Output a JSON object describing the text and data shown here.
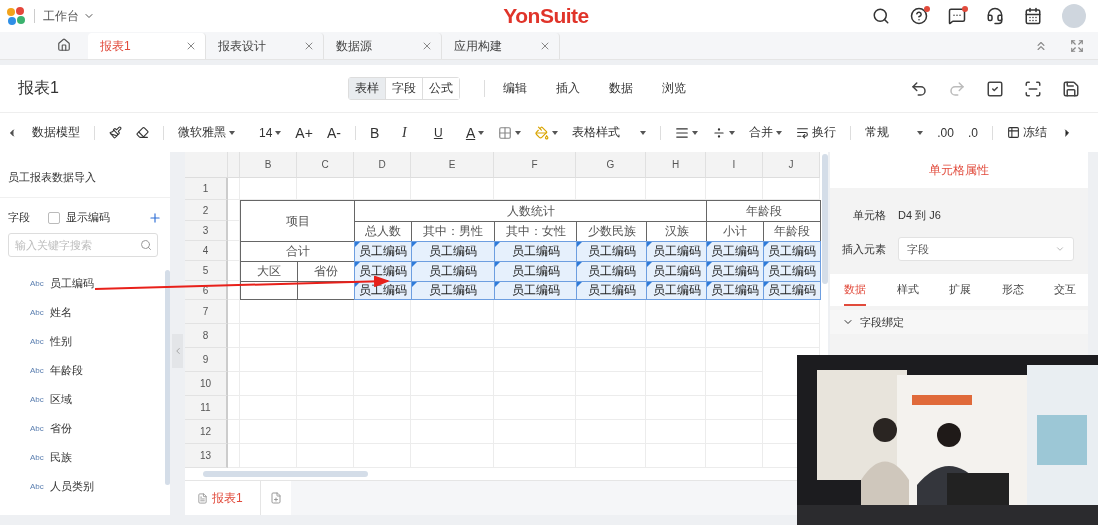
{
  "top_bar": {
    "workspace": "工作台",
    "brand": "YonSuite",
    "help_badge": true,
    "messages_badge": true
  },
  "tabs": [
    {
      "label": "报表1",
      "selected": true
    },
    {
      "label": "报表设计",
      "selected": false
    },
    {
      "label": "数据源",
      "selected": false
    },
    {
      "label": "应用构建",
      "selected": false
    }
  ],
  "header": {
    "title": "报表1",
    "modes": [
      {
        "label": "表样",
        "selected": true
      },
      {
        "label": "字段",
        "selected": false
      },
      {
        "label": "公式",
        "selected": false
      }
    ],
    "menu": [
      "编辑",
      "插入",
      "数据",
      "浏览"
    ]
  },
  "toolbar": {
    "data_model": "数据模型",
    "font": "微软雅黑",
    "size": "14",
    "grow": "A+",
    "shrink": "A-",
    "bold": "B",
    "italic": "I",
    "underline": "U",
    "font_color": "A",
    "table_style": "表格样式",
    "merge": "合并",
    "wrap": "换行",
    "format": "常规",
    "decimals_more": ".00",
    "decimals_less": ".0",
    "freeze": "冻结"
  },
  "field_panel": {
    "title": "员工报表数据导入",
    "fields_label": "字段",
    "show_code": {
      "label": "显示编码",
      "checked": false
    },
    "search": {
      "placeholder": "输入关键字搜索"
    },
    "fields": [
      {
        "type": "Abc",
        "name": "员工编码"
      },
      {
        "type": "Abc",
        "name": "姓名"
      },
      {
        "type": "Abc",
        "name": "性别"
      },
      {
        "type": "Abc",
        "name": "年龄段"
      },
      {
        "type": "Abc",
        "name": "区域"
      },
      {
        "type": "Abc",
        "name": "省份"
      },
      {
        "type": "Abc",
        "name": "民族"
      },
      {
        "type": "Abc",
        "name": "人员类别"
      }
    ]
  },
  "sheet": {
    "columns": [
      "B",
      "C",
      "D",
      "E",
      "F",
      "G",
      "H",
      "I",
      "J"
    ],
    "rows": [
      "1",
      "2",
      "3",
      "4",
      "5",
      "6",
      "7",
      "8",
      "9",
      "10",
      "11",
      "12",
      "13"
    ],
    "table": {
      "corner": "项目",
      "group_headers": [
        "人数统计",
        "年龄段"
      ],
      "sub_headers": [
        "总人数",
        "其中：男性",
        "其中：女性",
        "少数民族",
        "汉族",
        "小计",
        "年龄段"
      ],
      "total_label": "合计",
      "region_labels": [
        "大区",
        "省份"
      ],
      "field_rows": [
        [
          {
            "text": "员工编码",
            "selected": true
          },
          {
            "text": "员工编码",
            "selected": true
          },
          {
            "text": "员工编码",
            "selected": true
          },
          {
            "text": "员工编码",
            "selected": true
          },
          {
            "text": "员工编码",
            "selected": true
          },
          {
            "text": "员工编码",
            "selected": true
          },
          {
            "text": "员工编码",
            "selected": true
          }
        ],
        [
          {
            "text": "员工编码",
            "selected": true
          },
          {
            "text": "员工编码",
            "selected": true
          },
          {
            "text": "员工编码",
            "selected": true
          },
          {
            "text": "员工编码",
            "selected": true
          },
          {
            "text": "员工编码",
            "selected": true
          },
          {
            "text": "员工编码",
            "selected": true
          },
          {
            "text": "员工编码",
            "selected": true
          }
        ],
        [
          {
            "text": "员工编码",
            "selected": true
          },
          {
            "text": "员工编码",
            "selected": true
          },
          {
            "text": "员工编码",
            "selected": true
          },
          {
            "text": "员工编码",
            "selected": true
          },
          {
            "text": "员工编码",
            "selected": true
          },
          {
            "text": "员工编码",
            "selected": true
          },
          {
            "text": "员工编码",
            "selected": true
          }
        ]
      ]
    },
    "sheet_tabs": [
      {
        "label": "报表1",
        "selected": true
      }
    ]
  },
  "properties": {
    "title": "单元格属性",
    "cell_label": "单元格",
    "cell_range": "D4 到 J6",
    "insert_label": "插入元素",
    "insert_value": "字段",
    "tabs": [
      {
        "label": "数据",
        "selected": true
      },
      {
        "label": "样式",
        "selected": false
      },
      {
        "label": "扩展",
        "selected": false
      },
      {
        "label": "形态",
        "selected": false
      },
      {
        "label": "交互",
        "selected": false
      }
    ],
    "section": {
      "label": "字段绑定",
      "expanded": true
    }
  }
}
